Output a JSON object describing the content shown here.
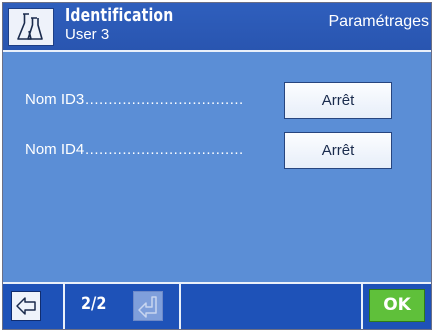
{
  "header": {
    "icon": "flasks-icon",
    "title": "Identification",
    "subtitle": "User 3",
    "section": "Paramétrages"
  },
  "rows": [
    {
      "label": "Nom ID3",
      "leader": "..................................",
      "value": "Arrêt"
    },
    {
      "label": "Nom ID4",
      "leader": "..................................",
      "value": "Arrêt"
    }
  ],
  "footer": {
    "back_icon": "arrow-left-icon",
    "page": "2/2",
    "next_icon": "arrow-down-left-icon",
    "ok_label": "OK"
  },
  "colors": {
    "background": "#5b8ed6",
    "header": "#2f5fbd",
    "footer": "#1e52b8",
    "ok": "#5fc03a"
  }
}
